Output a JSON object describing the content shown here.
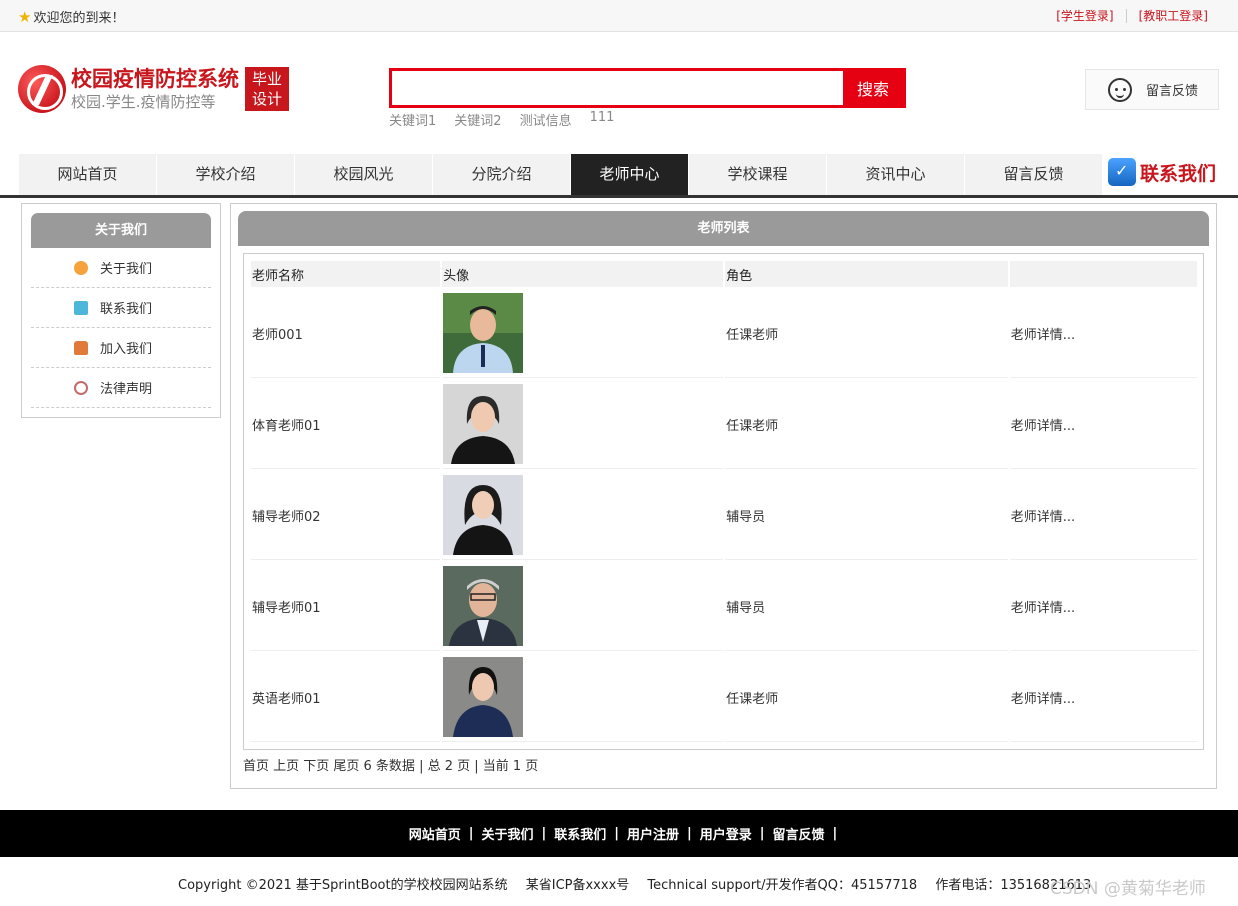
{
  "topbar": {
    "welcome": "欢迎您的到来！",
    "student_login": "[学生登录]",
    "staff_login": "[教职工登录]"
  },
  "header": {
    "logo_title": "校园疫情防控系统",
    "logo_subtitle": "校园.学生.疫情防控等",
    "badge_line1": "毕业",
    "badge_line2": "设计",
    "search_value": "",
    "search_button": "搜索",
    "keywords": [
      "关键词1",
      "关键词2",
      "测试信息",
      "111"
    ],
    "feedback": "留言反馈"
  },
  "nav": {
    "items": [
      "网站首页",
      "学校介绍",
      "校园风光",
      "分院介绍",
      "老师中心",
      "学校课程",
      "资讯中心",
      "留言反馈"
    ],
    "active": "老师中心",
    "contact": "联系我们"
  },
  "sidebar": {
    "title": "关于我们",
    "items": [
      {
        "label": "关于我们",
        "icon": "info-icon"
      },
      {
        "label": "联系我们",
        "icon": "clipboard-icon"
      },
      {
        "label": "加入我们",
        "icon": "lock-icon"
      },
      {
        "label": "法律声明",
        "icon": "power-icon"
      }
    ]
  },
  "main": {
    "title": "老师列表",
    "columns": [
      "老师名称",
      "头像",
      "角色",
      ""
    ],
    "rows": [
      {
        "name": "老师001",
        "role": "任课老师",
        "detail": "老师详情..."
      },
      {
        "name": "体育老师01",
        "role": "任课老师",
        "detail": "老师详情..."
      },
      {
        "name": "辅导老师02",
        "role": "辅导员",
        "detail": "老师详情..."
      },
      {
        "name": "辅导老师01",
        "role": "辅导员",
        "detail": "老师详情..."
      },
      {
        "name": "英语老师01",
        "role": "任课老师",
        "detail": "老师详情..."
      }
    ],
    "pager": "首页 上页 下页 尾页 6 条数据 | 总 2 页 | 当前 1 页"
  },
  "footer": {
    "links": [
      "网站首页",
      "关于我们",
      "联系我们",
      "用户注册",
      "用户登录",
      "留言反馈"
    ],
    "copyright": "Copyright ©2021 基于SprintBoot的学校校园网站系统",
    "icp": "某省ICP备xxxx号",
    "support": "Technical support/开发作者QQ：45157718",
    "phone": "作者电话：13516821613",
    "watermark": "CSDN @黄菊华老师"
  },
  "colors": {
    "brand_red": "#c8161d",
    "search_red": "#e50012",
    "header_gray": "#9a9a9a",
    "nav_active": "#222222"
  }
}
